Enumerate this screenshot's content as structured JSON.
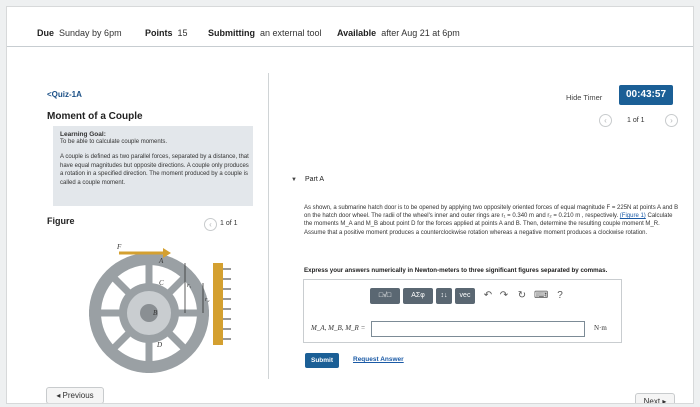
{
  "assignment": {
    "due_label": "Due",
    "due_value": "Sunday by 6pm",
    "points_label": "Points",
    "points_value": "15",
    "submitting_label": "Submitting",
    "submitting_value": "an external tool",
    "available_label": "Available",
    "available_value": "after Aug 21 at 6pm"
  },
  "quiz": {
    "back_label": "Quiz-1A",
    "title": "Moment of a Couple",
    "hide_timer": "Hide Timer",
    "timer": "00:43:57",
    "pager": "1 of 1"
  },
  "learning_goal": {
    "heading": "Learning Goal:",
    "goal": "To be able to calculate couple moments.",
    "text": "A couple is defined as two parallel forces, separated by a distance, that have equal magnitudes but opposite directions. A couple only produces a rotation in a specified direction. The moment produced by a couple is called a couple moment."
  },
  "figure_panel": {
    "label": "Figure",
    "pager": "1 of 1",
    "labels": {
      "F": "F",
      "A": "A",
      "C": "C",
      "B": "B",
      "D": "D",
      "r1": "r₁",
      "r2": "r₂"
    }
  },
  "part_a": {
    "label": "Part A",
    "problem": "As shown, a submarine hatch door is to be opened by applying two oppositely oriented forces of equal magnitude F = 225N at points A and B on the hatch door wheel. The radii of the wheel's inner and outer rings are r₁ = 0.340 m and r₂ = 0.210 m , respectively.",
    "figure_link": "(Figure 1)",
    "problem_cont": "Calculate the moments M_A and M_B about point D for the forces applied at points A and B. Then, determine the resulting couple moment M_R. Assume that a positive moment produces a counterclockwise rotation whereas a negative moment produces a clockwise rotation.",
    "instruction": "Express your answers numerically in Newton-meters to three significant figures separated by commas."
  },
  "answer": {
    "toolbar": {
      "templates": "□√□",
      "symbols": "AΣφ",
      "arrows": "↕↓",
      "vec": "vec",
      "undo": "↶",
      "redo": "↷",
      "reset": "↻",
      "keyboard": "⌨",
      "help": "?"
    },
    "eq_label": "M_A, M_B, M_R =",
    "value": "",
    "unit": "N·m"
  },
  "actions": {
    "submit": "Submit",
    "request_answer": "Request Answer"
  },
  "nav": {
    "previous": "◂ Previous",
    "next": "Next ▸"
  },
  "colors": {
    "accent": "#1b5f96",
    "link": "#1a5aa6",
    "goal_bg": "#e3e7eb",
    "figure_wheel": "#8a8f93",
    "figure_force": "#d4a030"
  }
}
